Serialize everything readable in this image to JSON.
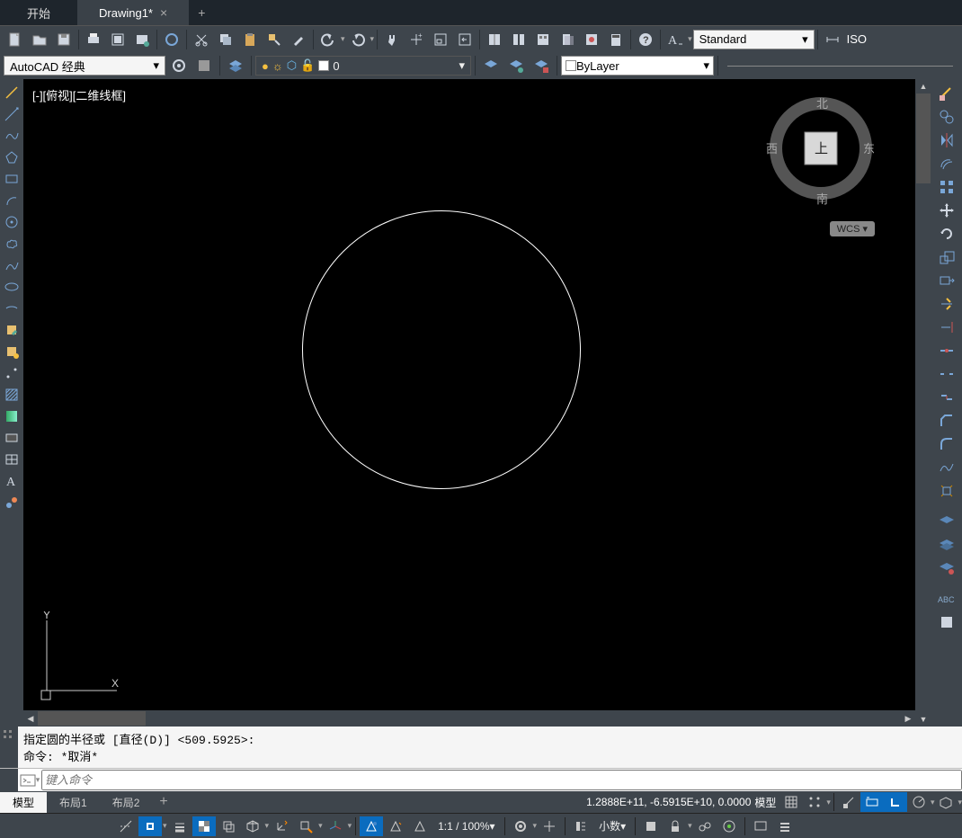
{
  "tabs": {
    "start": "开始",
    "drawing": "Drawing1*",
    "close": "×",
    "add": "+"
  },
  "workspace": "AutoCAD 经典",
  "textstyle": "Standard",
  "textstyle2": "ISO",
  "layer_line": {
    "name": "0"
  },
  "bylayer": "ByLayer",
  "view_label": "[-][俯视][二维线框]",
  "nav": {
    "n": "北",
    "s": "南",
    "e": "东",
    "w": "西",
    "top": "上"
  },
  "wcs": "WCS",
  "cmd_history": "指定圆的半径或 [直径(D)] <509.5925>:\n命令: *取消*",
  "cmd_placeholder": "键入命令",
  "layout_tabs": {
    "model": "模型",
    "l1": "布局1",
    "l2": "布局2"
  },
  "status": {
    "coords": "1.2888E+11, -6.5915E+10, 0.0000",
    "model": "模型",
    "zoom": "1:1 / 100%",
    "dec": "小数"
  }
}
